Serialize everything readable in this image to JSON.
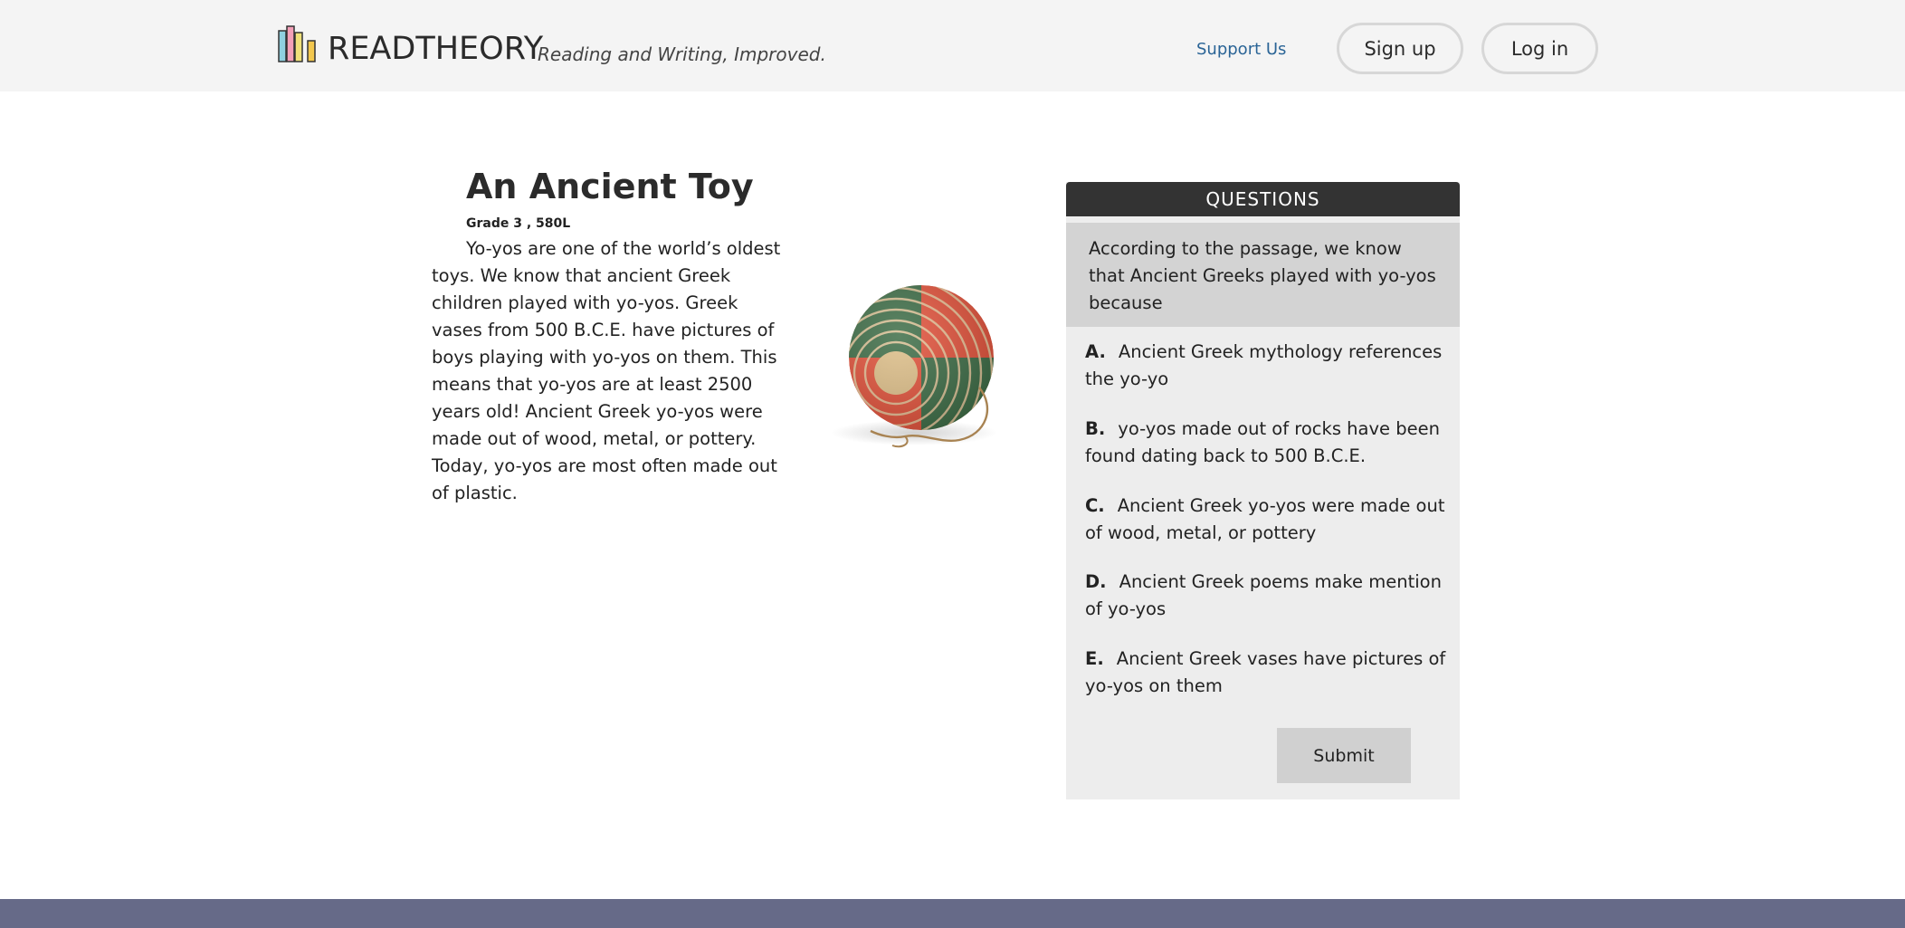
{
  "header": {
    "brand": "READTHEORY",
    "tagline": "Reading and Writing, Improved.",
    "logo_icon": "books-logo-icon",
    "support_label": "Support Us",
    "signup_label": "Sign up",
    "login_label": "Log in",
    "link_color": "#2a6496"
  },
  "passage": {
    "title": "An Ancient Toy",
    "grade": "Grade 3 , 580L",
    "body": "Yo-yos are one of the world’s oldest toys. We know that ancient Greek children played with yo-yos. Greek vases from 500 B.C.E. have pictures of boys playing with yo-yos on them. This means that yo-yos are at least 2500 years old! Ancient Greek yo-yos were made out of wood, metal, or pottery. Today, yo-yos are most often made out of plastic.",
    "image": "yoyo-image",
    "image_colors": {
      "green": "#3f6e48",
      "red": "#e2533c",
      "center": "#dfc08a"
    }
  },
  "questions": {
    "header": "QUESTIONS",
    "prompt": "According to the passage, we know that Ancient Greeks played with yo-yos because",
    "options": [
      {
        "letter": "A.",
        "text": "Ancient Greek mythology references the yo-yo"
      },
      {
        "letter": "B.",
        "text": "yo-yos made out of rocks have been found dating back to 500 B.C.E."
      },
      {
        "letter": "C.",
        "text": "Ancient Greek yo-yos were made out of wood, metal, or pottery"
      },
      {
        "letter": "D.",
        "text": "Ancient Greek poems make mention of yo-yos"
      },
      {
        "letter": "E.",
        "text": "Ancient Greek vases have pictures of yo-yos on them"
      }
    ],
    "submit_label": "Submit"
  },
  "colors": {
    "header_bg": "#f4f4f4",
    "panel_bg": "#ededed",
    "panel_header_bg": "#333333",
    "prompt_bg": "#d3d3d3",
    "footer_bg": "#666a88"
  }
}
